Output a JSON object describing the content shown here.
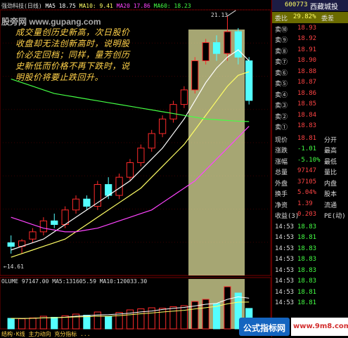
{
  "header": {
    "title": "强劲科技(日线)",
    "ma5": "MA5 18.75",
    "ma10": "MA10: 9.41",
    "ma20": "MA20 17.86",
    "ma60": "MA60: 18.23"
  },
  "watermarks": {
    "top": "股旁网 www.gupang.com",
    "mid": "",
    "ad_left": "公式指标网",
    "ad_right": "www.9m8.com"
  },
  "annotation": "成交量创历史新高，次日股价收盘却无法创新高时，说明股价必定回档；同样，量芳创历史新低而价格不再下跌时，说明股价将要止跌回升。",
  "labels": {
    "peak": "21.13",
    "low": "←14.61"
  },
  "volume_header": {
    "volume": "OLUME 97147.00",
    "ma5": "MA5:131605.59",
    "ma10": "MA10:120033.30"
  },
  "bottom_text": "结构·K线  主力动向  充分指标 ...",
  "panel": {
    "code": "600773",
    "name": "西藏城投",
    "ratio_label": "委比",
    "ratio_value": "29.82%",
    "diff_label": "委差",
    "sell": [
      {
        "label": "卖⑩",
        "price": "18.93"
      },
      {
        "label": "卖⑨",
        "price": "18.92"
      },
      {
        "label": "卖⑧",
        "price": "18.91"
      },
      {
        "label": "卖⑦",
        "price": "18.90"
      },
      {
        "label": "卖⑥",
        "price": "18.88"
      },
      {
        "label": "卖⑤",
        "price": "18.87"
      },
      {
        "label": "卖④",
        "price": "18.86"
      },
      {
        "label": "卖③",
        "price": "18.85"
      },
      {
        "label": "卖②",
        "price": "18.84"
      },
      {
        "label": "卖①",
        "price": "18.83"
      }
    ],
    "stats": [
      {
        "label": "现价",
        "value": "18.81",
        "label2": "分开",
        "value2": ""
      },
      {
        "label": "涨跌",
        "value": "-1.01",
        "label2": "最高",
        "value2": ""
      },
      {
        "label": "涨幅",
        "value": "-5.10%",
        "label2": "最低",
        "value2": ""
      },
      {
        "label": "总量",
        "value": "97147",
        "label2": "量比",
        "value2": ""
      },
      {
        "label": "外盘",
        "value": "37105",
        "label2": "内盘",
        "value2": ""
      },
      {
        "label": "换手",
        "value": "5.04%",
        "label2": "股本",
        "value2": ""
      },
      {
        "label": "净资",
        "value": "1.39",
        "label2": "流通",
        "value2": ""
      },
      {
        "label": "收益(3)",
        "value": "0.203",
        "label2": "PE(动)",
        "value2": ""
      }
    ],
    "ticks": [
      {
        "time": "14:53",
        "price": "18.83"
      },
      {
        "time": "14:53",
        "price": "18.81"
      },
      {
        "time": "14:53",
        "price": "18.83"
      },
      {
        "time": "14:53",
        "price": "18.83"
      },
      {
        "time": "14:53",
        "price": "18.83"
      },
      {
        "time": "14:53",
        "price": "18.83"
      },
      {
        "time": "14:53",
        "price": "18.81"
      },
      {
        "time": "14:53",
        "price": "18.81"
      }
    ],
    "axis_ticks": [
      "21.00",
      "20.50",
      "20.00",
      "19.50",
      "19.00",
      "18.50",
      "18.00",
      "17.50",
      "17.00",
      "16.50",
      "16.00",
      "15.50",
      "15.00",
      "14.50"
    ]
  },
  "chart_data": {
    "type": "candlestick",
    "title": "强劲科技(日线)",
    "price_range": [
      14.0,
      21.3
    ],
    "volume_range": [
      0,
      21000
    ],
    "volume_ticks": [
      "20000",
      "15000",
      "10000"
    ],
    "highlight_window": {
      "from_index": 17,
      "to_index": 21,
      "color": "#e6e6a0"
    },
    "candles": [
      {
        "o": 14.9,
        "h": 15.1,
        "l": 14.6,
        "c": 14.8,
        "v": 5000
      },
      {
        "o": 14.8,
        "h": 15.0,
        "l": 14.6,
        "c": 14.95,
        "v": 4800
      },
      {
        "o": 15.0,
        "h": 15.3,
        "l": 14.9,
        "c": 15.2,
        "v": 5200
      },
      {
        "o": 15.2,
        "h": 15.6,
        "l": 15.1,
        "c": 15.5,
        "v": 6000
      },
      {
        "o": 15.5,
        "h": 15.7,
        "l": 15.3,
        "c": 15.4,
        "v": 5500
      },
      {
        "o": 15.4,
        "h": 15.9,
        "l": 15.3,
        "c": 15.8,
        "v": 6200
      },
      {
        "o": 15.8,
        "h": 16.2,
        "l": 15.7,
        "c": 16.1,
        "v": 7000
      },
      {
        "o": 16.1,
        "h": 16.2,
        "l": 15.8,
        "c": 15.9,
        "v": 6500
      },
      {
        "o": 15.9,
        "h": 16.6,
        "l": 15.8,
        "c": 16.5,
        "v": 8000
      },
      {
        "o": 16.5,
        "h": 16.7,
        "l": 16.1,
        "c": 16.2,
        "v": 6000
      },
      {
        "o": 16.2,
        "h": 16.8,
        "l": 16.1,
        "c": 16.7,
        "v": 7800
      },
      {
        "o": 16.7,
        "h": 17.2,
        "l": 16.6,
        "c": 17.1,
        "v": 9000
      },
      {
        "o": 17.1,
        "h": 17.6,
        "l": 17.0,
        "c": 17.5,
        "v": 9500
      },
      {
        "o": 17.5,
        "h": 18.0,
        "l": 17.4,
        "c": 17.9,
        "v": 10000
      },
      {
        "o": 17.9,
        "h": 18.4,
        "l": 17.8,
        "c": 18.3,
        "v": 9800
      },
      {
        "o": 18.3,
        "h": 18.8,
        "l": 18.2,
        "c": 18.7,
        "v": 10500
      },
      {
        "o": 18.7,
        "h": 19.2,
        "l": 18.6,
        "c": 19.1,
        "v": 11000
      },
      {
        "o": 19.1,
        "h": 20.0,
        "l": 19.0,
        "c": 19.9,
        "v": 13000
      },
      {
        "o": 19.9,
        "h": 20.5,
        "l": 19.8,
        "c": 20.4,
        "v": 14000
      },
      {
        "o": 20.4,
        "h": 20.6,
        "l": 19.9,
        "c": 20.1,
        "v": 12000
      },
      {
        "o": 20.1,
        "h": 21.13,
        "l": 19.9,
        "c": 20.7,
        "v": 20000
      },
      {
        "o": 20.7,
        "h": 20.8,
        "l": 19.8,
        "c": 20.0,
        "v": 17000
      },
      {
        "o": 19.9,
        "h": 20.0,
        "l": 18.7,
        "c": 18.81,
        "v": 9700
      }
    ],
    "ma_series": [
      {
        "name": "MA5",
        "color": "#ffffff",
        "values": [
          14.7,
          14.8,
          14.9,
          15.0,
          15.2,
          15.4,
          15.6,
          15.8,
          16.0,
          16.2,
          16.4,
          16.6,
          16.9,
          17.2,
          17.5,
          17.9,
          18.3,
          18.8,
          19.3,
          19.7,
          20.0,
          20.2,
          19.9
        ]
      },
      {
        "name": "MA10",
        "color": "#ffff66",
        "values": [
          14.5,
          14.6,
          14.7,
          14.8,
          14.9,
          15.0,
          15.2,
          15.4,
          15.6,
          15.8,
          16.0,
          16.2,
          16.4,
          16.7,
          17.0,
          17.3,
          17.6,
          18.0,
          18.4,
          18.8,
          19.2,
          19.5,
          19.6
        ]
      },
      {
        "name": "MA20",
        "color": "#ff44ff",
        "values": [
          15.6,
          15.5,
          15.4,
          15.3,
          15.25,
          15.2,
          15.2,
          15.25,
          15.3,
          15.4,
          15.5,
          15.6,
          15.7,
          15.8,
          16.0,
          16.2,
          16.4,
          16.6,
          16.9,
          17.2,
          17.5,
          17.8,
          18.1
        ]
      },
      {
        "name": "MA60",
        "color": "#44ff44",
        "values": [
          19.4,
          19.3,
          19.2,
          19.1,
          19.0,
          18.95,
          18.9,
          18.85,
          18.8,
          18.75,
          18.7,
          18.65,
          18.6,
          18.55,
          18.5,
          18.45,
          18.4,
          18.35,
          18.3,
          18.28,
          18.26,
          18.24,
          18.23
        ]
      }
    ]
  }
}
